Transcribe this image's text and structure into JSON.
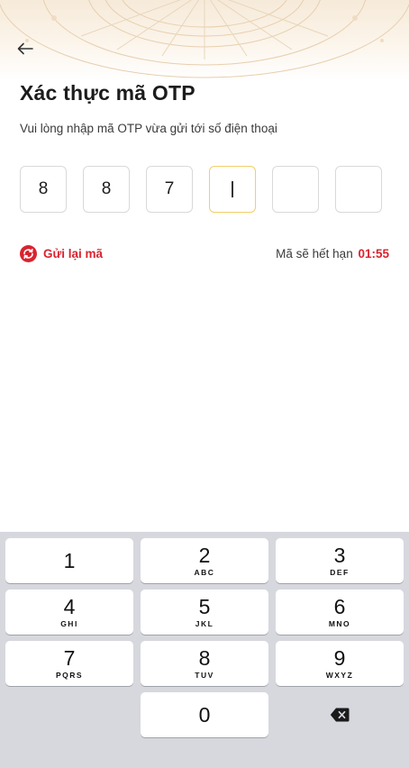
{
  "header": {
    "back_icon": "arrow-left-icon"
  },
  "title": "Xác thực mã OTP",
  "subtitle": "Vui lòng nhập mã OTP vừa gửi tới số điện thoại",
  "otp": {
    "digits": [
      "8",
      "8",
      "7",
      "",
      "",
      ""
    ],
    "active_index": 3
  },
  "resend": {
    "icon": "refresh-icon",
    "label": "Gửi lại mã"
  },
  "expiry": {
    "label": "Mã sẽ hết hạn",
    "time": "01:55"
  },
  "colors": {
    "accent_red": "#d9232e",
    "active_border": "#f2cf6b",
    "keyboard_bg": "#d6d8de"
  },
  "keypad": {
    "keys": [
      {
        "digit": "1",
        "letters": ""
      },
      {
        "digit": "2",
        "letters": "ABC"
      },
      {
        "digit": "3",
        "letters": "DEF"
      },
      {
        "digit": "4",
        "letters": "GHI"
      },
      {
        "digit": "5",
        "letters": "JKL"
      },
      {
        "digit": "6",
        "letters": "MNO"
      },
      {
        "digit": "7",
        "letters": "PQRS"
      },
      {
        "digit": "8",
        "letters": "TUV"
      },
      {
        "digit": "9",
        "letters": "WXYZ"
      },
      {
        "digit": "0",
        "letters": ""
      }
    ],
    "delete_icon": "backspace-icon"
  }
}
